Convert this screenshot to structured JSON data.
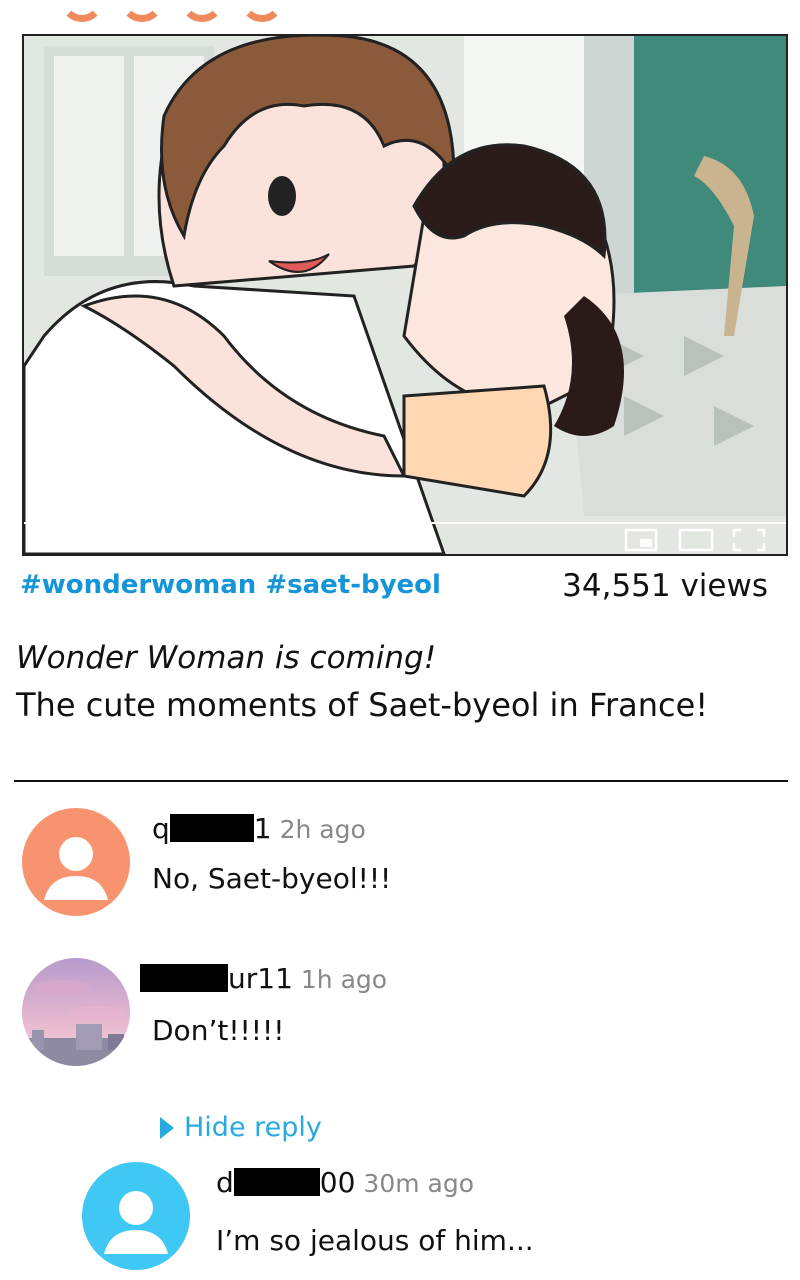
{
  "post": {
    "hashtags": "#wonderwoman #saet-byeol",
    "views": "34,551 views",
    "title_line1": "Wonder Woman is coming!",
    "title_line2": "The cute moments of Saet-byeol in France!"
  },
  "player": {
    "controls": [
      "play-icon",
      "next-icon",
      "volume-icon",
      "miniplayer-icon",
      "theater-icon",
      "fullscreen-icon"
    ]
  },
  "comments": [
    {
      "user_prefix": "q",
      "user_suffix": "1",
      "time": "2h ago",
      "text": "No, Saet-byeol!!!",
      "avatar_color": "#f7936f"
    },
    {
      "user_prefix": "",
      "user_suffix": "ur11",
      "time": "1h ago",
      "text": "Don’t!!!!!",
      "avatar_color": "#c9a6c8"
    }
  ],
  "hide_reply_label": "Hide reply",
  "reply": {
    "user_prefix": "d",
    "user_suffix": "00",
    "time": "30m ago",
    "text": "I’m so jealous of him...",
    "avatar_color": "#3fc8f3"
  },
  "colors": {
    "hashtag": "#1595d8",
    "hide_reply": "#27a9e1"
  }
}
